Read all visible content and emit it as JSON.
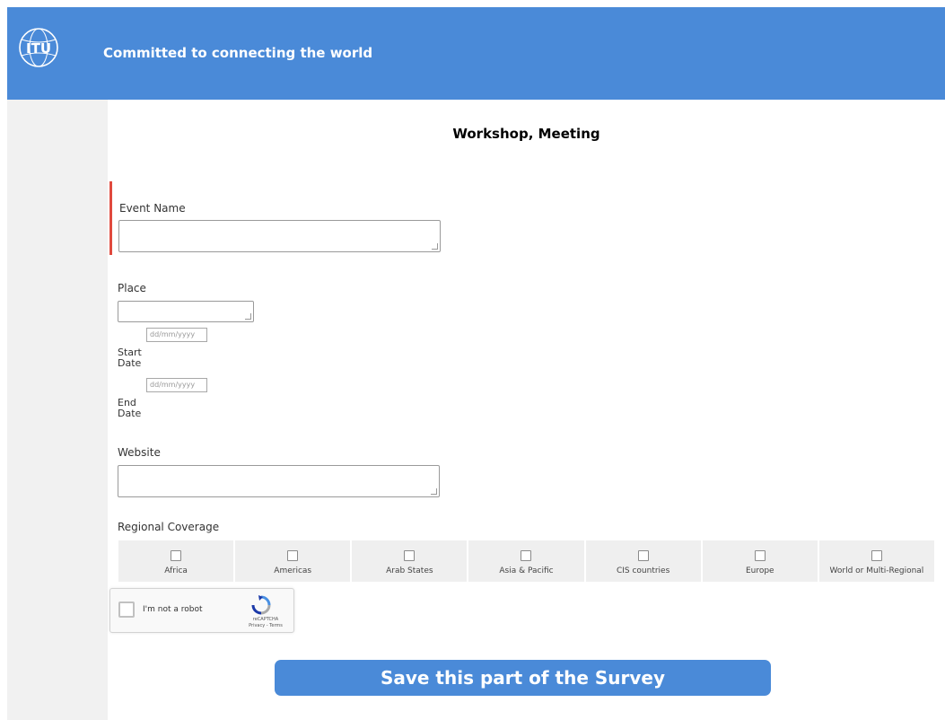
{
  "header": {
    "logo_text": "ITU",
    "tagline": "Committed to connecting the world"
  },
  "form": {
    "title": "Workshop, Meeting",
    "event_name": {
      "label": "Event Name",
      "value": ""
    },
    "place": {
      "label": "Place",
      "value": ""
    },
    "start_date": {
      "label_line1": "Start",
      "label_line2": "Date",
      "placeholder": "dd/mm/yyyy"
    },
    "end_date": {
      "label_line1": "End",
      "label_line2": "Date",
      "placeholder": "dd/mm/yyyy"
    },
    "website": {
      "label": "Website",
      "value": ""
    },
    "regional_coverage": {
      "label": "Regional Coverage",
      "options": [
        {
          "label": "Africa",
          "checked": false
        },
        {
          "label": "Americas",
          "checked": false
        },
        {
          "label": "Arab States",
          "checked": false
        },
        {
          "label": "Asia & Pacific",
          "checked": false
        },
        {
          "label": "CIS countries",
          "checked": false
        },
        {
          "label": "Europe",
          "checked": false
        },
        {
          "label": "World or Multi-Regional",
          "checked": false
        }
      ]
    },
    "captcha": {
      "label": "I'm not a robot",
      "brand": "reCAPTCHA",
      "links": "Privacy - Terms"
    },
    "save_label": "Save this part of the Survey"
  },
  "colors": {
    "header_bg": "#4a8ad8",
    "button_bg": "#4a8ad8",
    "error_bar": "#e04a3e"
  }
}
